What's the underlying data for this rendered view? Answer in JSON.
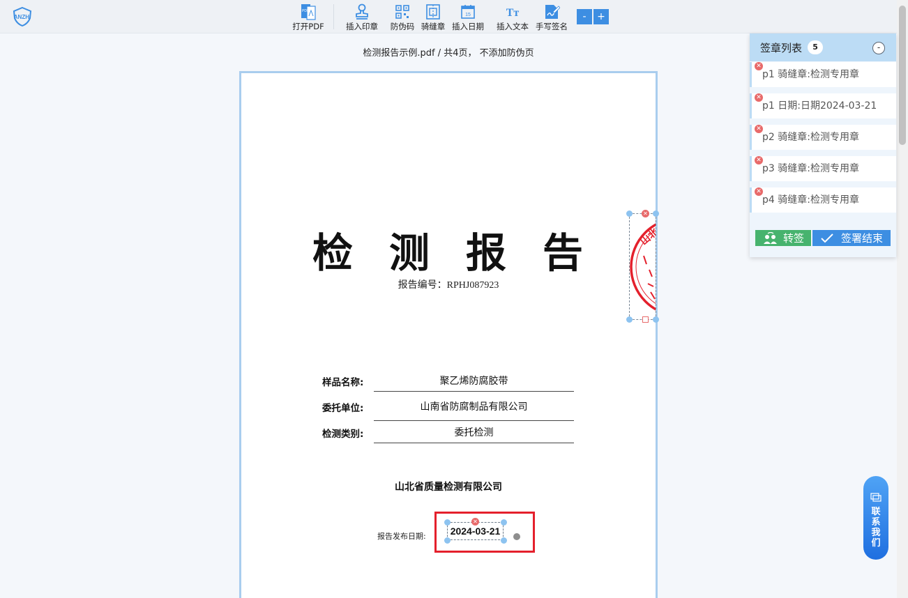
{
  "toolbar": {
    "items": [
      {
        "label": "打开PDF",
        "icon": "pdf-file-icon"
      },
      {
        "label": "插入印章",
        "icon": "stamp-icon"
      },
      {
        "label": "防伪码",
        "icon": "qr-code-icon"
      },
      {
        "label": "骑缝章",
        "icon": "seam-seal-icon"
      },
      {
        "label": "插入日期",
        "icon": "calendar-icon"
      },
      {
        "label": "插入文本",
        "icon": "text-icon"
      },
      {
        "label": "手写签名",
        "icon": "signature-icon"
      }
    ],
    "zoom_out": "-",
    "zoom_in": "+",
    "calendar_day": "15",
    "text_icon_glyph": "Tт"
  },
  "logo": {
    "text": "ANZHI"
  },
  "doc_info": "检测报告示例.pdf / 共4页，  不添加防伪页",
  "report": {
    "title": "检测报告",
    "number_line": "报告编号：RPHJ087923",
    "fields": [
      {
        "label": "样品名称:",
        "value": "聚乙烯防腐胶带"
      },
      {
        "label": "委托单位:",
        "value": "山南省防腐制品有限公司"
      },
      {
        "label": "检测类别:",
        "value": "委托检测"
      }
    ],
    "company": "山北省质量检测有限公司",
    "publish_label": "报告发布日期:",
    "publish_date": "2024-03-21",
    "seal_text_fragment": "山北省"
  },
  "sidebar": {
    "title": "签章列表",
    "count": "5",
    "collapse": "-",
    "items": [
      "p1 骑缝章:检测专用章",
      "p1 日期:日期2024-03-21",
      "p2 骑缝章:检测专用章",
      "p3 骑缝章:检测专用章",
      "p4 骑缝章:检测专用章"
    ],
    "transfer_label": "转签",
    "finish_label": "签署结束"
  },
  "contact": {
    "label": "联系我们"
  },
  "colors": {
    "accent": "#3d8ee2",
    "green": "#47b36e",
    "danger": "#e4202c",
    "seal": "#e4202c"
  }
}
